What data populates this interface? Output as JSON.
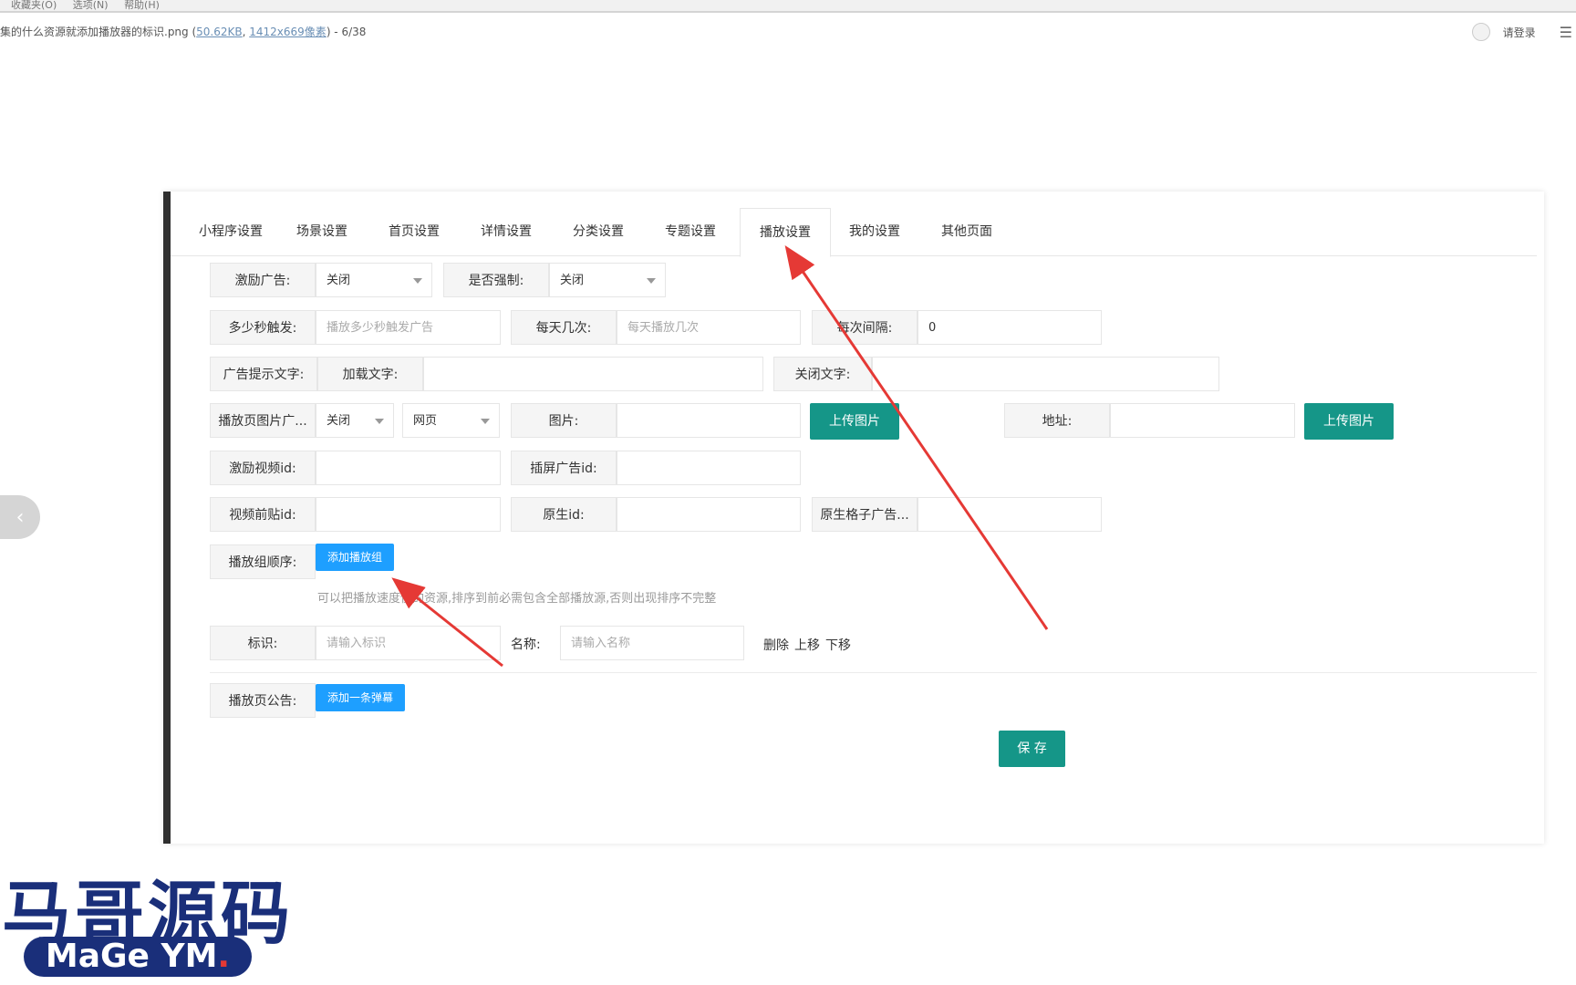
{
  "menubar": [
    "收藏夹(O)",
    "选项(N)",
    "帮助(H)"
  ],
  "infobar": {
    "filename": "集的什么资源就添加播放器的标识.png (",
    "size": "50.62KB",
    "sep": ", ",
    "dims": "1412x669像素",
    "tail": ") - 6/38"
  },
  "user": {
    "login": "请登录",
    "menu_icon": "☰"
  },
  "nav": {
    "prev_icon": "‹"
  },
  "tabs": [
    "小程序设置",
    "场景设置",
    "首页设置",
    "详情设置",
    "分类设置",
    "专题设置",
    "播放设置",
    "我的设置",
    "其他页面"
  ],
  "active_tab": "播放设置",
  "form": {
    "reward_ad_label": "激励广告:",
    "reward_ad_value": "关闭",
    "force_label": "是否强制:",
    "force_value": "关闭",
    "seconds_label": "多少秒触发:",
    "seconds_placeholder": "播放多少秒触发广告",
    "daily_label": "每天几次:",
    "daily_placeholder": "每天播放几次",
    "interval_label": "每次间隔:",
    "interval_value": "0",
    "tip_text_label": "广告提示文字:",
    "loading_label": "加载文字:",
    "close_text_label": "关闭文字:",
    "image_ad_label": "播放页图片广...",
    "image_ad_value": "关闭",
    "page_type_value": "网页",
    "image_label": "图片:",
    "upload_image": "上传图片",
    "address_label": "地址:",
    "upload_image2": "上传图片",
    "reward_video_label": "激励视频id:",
    "interstitial_label": "插屏广告id:",
    "preroll_label": "视频前贴id:",
    "native_label": "原生id:",
    "native_grid_label": "原生格子广告...",
    "group_order_label": "播放组顺序:",
    "add_group": "添加播放组",
    "hint": "可以把播放速度快的资源,排序到前必需包含全部播放源,否则出现排序不完整",
    "tag_label": "标识:",
    "tag_placeholder": "请输入标识",
    "name_label": "名称:",
    "name_placeholder": "请输入名称",
    "op_delete": "删除",
    "op_up": "上移",
    "op_down": "下移",
    "notice_label": "播放页公告:",
    "add_danmaku": "添加一条弹幕",
    "save": "保 存"
  },
  "watermark": {
    "cn": "马哥源码",
    "en": "MaGe YM",
    "dot": "."
  },
  "colors": {
    "primary_green": "#159688",
    "primary_blue": "#1e9fff",
    "arrow_red": "#e53935",
    "logo_navy": "#1a2f7a"
  }
}
